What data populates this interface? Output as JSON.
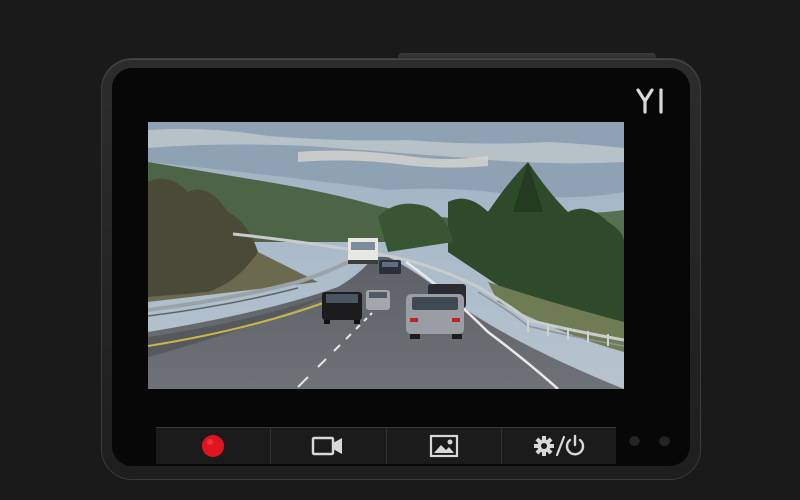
{
  "device": {
    "brand": "YI",
    "accent_color": "#e0141e"
  },
  "buttons": [
    {
      "name": "record",
      "icon": "record-dot-icon",
      "color": "#e0141e"
    },
    {
      "name": "video-mode",
      "icon": "video-camera-icon"
    },
    {
      "name": "photo-gallery",
      "icon": "image-icon"
    },
    {
      "name": "settings-power",
      "icon": "gear-slash-power-icon"
    }
  ],
  "indicators": [
    {
      "name": "status-led-1"
    },
    {
      "name": "status-led-2"
    }
  ],
  "screen": {
    "content": "road-camera-feed"
  }
}
